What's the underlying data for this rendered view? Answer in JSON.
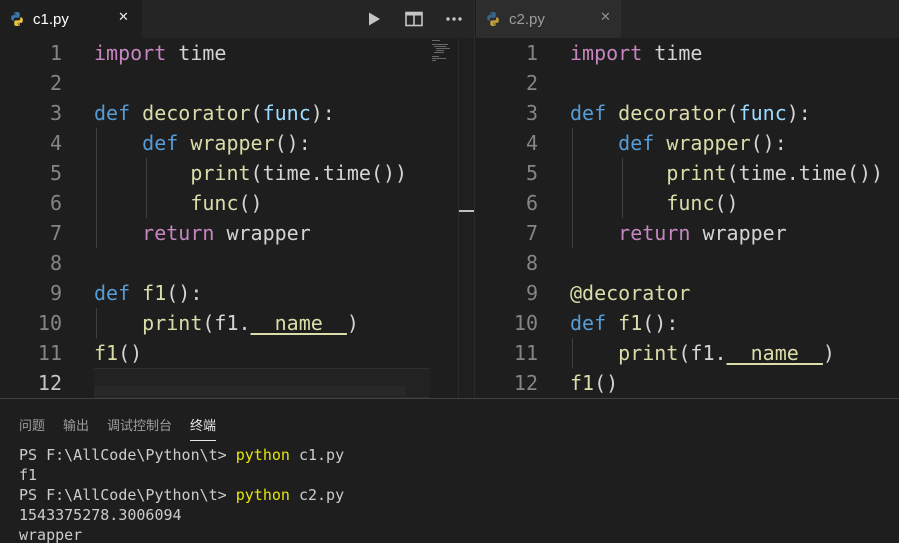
{
  "colors": {
    "background": "#1e1e1e",
    "tab_bar": "#252526",
    "keyword": "#569cd6",
    "control": "#c586c0",
    "function": "#dcdcaa",
    "variable": "#9cdcfe",
    "text": "#d4d4d4",
    "line_number": "#858585",
    "terminal_command": "#e5e510"
  },
  "left_editor": {
    "tab": {
      "label": "c1.py",
      "close": "✕",
      "icon": "python-file-icon"
    },
    "toolbar": {
      "run_icon": "play-icon",
      "split_icon": "split-editor-icon",
      "more_icon": "more-actions-icon"
    },
    "lines": [
      {
        "no": "1",
        "tokens": [
          [
            "kw-ctl",
            "import"
          ],
          [
            "plain",
            " time"
          ]
        ]
      },
      {
        "no": "2",
        "tokens": []
      },
      {
        "no": "3",
        "tokens": [
          [
            "kw",
            "def"
          ],
          [
            "plain",
            " "
          ],
          [
            "fn",
            "decorator"
          ],
          [
            "plain",
            "("
          ],
          [
            "var",
            "func"
          ],
          [
            "plain",
            "):"
          ]
        ]
      },
      {
        "no": "4",
        "tokens": [
          [
            "plain",
            "    "
          ],
          [
            "kw",
            "def"
          ],
          [
            "plain",
            " "
          ],
          [
            "fn",
            "wrapper"
          ],
          [
            "plain",
            "():"
          ]
        ]
      },
      {
        "no": "5",
        "tokens": [
          [
            "plain",
            "        "
          ],
          [
            "fn",
            "print"
          ],
          [
            "plain",
            "(time.time())"
          ]
        ]
      },
      {
        "no": "6",
        "tokens": [
          [
            "plain",
            "        "
          ],
          [
            "fn",
            "func"
          ],
          [
            "plain",
            "()"
          ]
        ]
      },
      {
        "no": "7",
        "tokens": [
          [
            "plain",
            "    "
          ],
          [
            "ctl",
            "return"
          ],
          [
            "plain",
            " wrapper"
          ]
        ]
      },
      {
        "no": "8",
        "tokens": []
      },
      {
        "no": "9",
        "tokens": [
          [
            "kw",
            "def"
          ],
          [
            "plain",
            " "
          ],
          [
            "fn",
            "f1"
          ],
          [
            "plain",
            "():"
          ]
        ]
      },
      {
        "no": "10",
        "tokens": [
          [
            "plain",
            "    "
          ],
          [
            "fn",
            "print"
          ],
          [
            "plain",
            "(f1."
          ],
          [
            "var-u",
            "__name__"
          ],
          [
            "plain",
            ")"
          ]
        ]
      },
      {
        "no": "11",
        "tokens": [
          [
            "fn",
            "f1"
          ],
          [
            "plain",
            "()"
          ]
        ]
      },
      {
        "no": "12",
        "tokens": []
      }
    ],
    "current_line": "12"
  },
  "right_editor": {
    "tab": {
      "label": "c2.py",
      "close": "✕",
      "icon": "python-file-icon"
    },
    "lines": [
      {
        "no": "1",
        "tokens": [
          [
            "kw-ctl",
            "import"
          ],
          [
            "plain",
            " time"
          ]
        ]
      },
      {
        "no": "2",
        "tokens": []
      },
      {
        "no": "3",
        "tokens": [
          [
            "kw",
            "def"
          ],
          [
            "plain",
            " "
          ],
          [
            "fn",
            "decorator"
          ],
          [
            "plain",
            "("
          ],
          [
            "var",
            "func"
          ],
          [
            "plain",
            "):"
          ]
        ]
      },
      {
        "no": "4",
        "tokens": [
          [
            "plain",
            "    "
          ],
          [
            "kw",
            "def"
          ],
          [
            "plain",
            " "
          ],
          [
            "fn",
            "wrapper"
          ],
          [
            "plain",
            "():"
          ]
        ]
      },
      {
        "no": "5",
        "tokens": [
          [
            "plain",
            "        "
          ],
          [
            "fn",
            "print"
          ],
          [
            "plain",
            "(time.time())"
          ]
        ]
      },
      {
        "no": "6",
        "tokens": [
          [
            "plain",
            "        "
          ],
          [
            "fn",
            "func"
          ],
          [
            "plain",
            "()"
          ]
        ]
      },
      {
        "no": "7",
        "tokens": [
          [
            "plain",
            "    "
          ],
          [
            "ctl",
            "return"
          ],
          [
            "plain",
            " wrapper"
          ]
        ]
      },
      {
        "no": "8",
        "tokens": []
      },
      {
        "no": "9",
        "tokens": [
          [
            "fn",
            "@decorator"
          ]
        ]
      },
      {
        "no": "10",
        "tokens": [
          [
            "kw",
            "def"
          ],
          [
            "plain",
            " "
          ],
          [
            "fn",
            "f1"
          ],
          [
            "plain",
            "():"
          ]
        ]
      },
      {
        "no": "11",
        "tokens": [
          [
            "plain",
            "    "
          ],
          [
            "fn",
            "print"
          ],
          [
            "plain",
            "(f1."
          ],
          [
            "var-u",
            "__name__"
          ],
          [
            "plain",
            ")"
          ]
        ]
      },
      {
        "no": "12",
        "tokens": [
          [
            "fn",
            "f1"
          ],
          [
            "plain",
            "()"
          ]
        ]
      }
    ]
  },
  "panel": {
    "tabs": [
      {
        "label": "问题",
        "active": false
      },
      {
        "label": "输出",
        "active": false
      },
      {
        "label": "调试控制台",
        "active": false
      },
      {
        "label": "终端",
        "active": true
      }
    ],
    "terminal": [
      {
        "prompt": "PS F:\\AllCode\\Python\\t> ",
        "cmd": "python",
        "args": " c1.py"
      },
      {
        "text": "f1"
      },
      {
        "prompt": "PS F:\\AllCode\\Python\\t> ",
        "cmd": "python",
        "args": " c2.py"
      },
      {
        "text": "1543375278.3006094"
      },
      {
        "text": "wrapper"
      }
    ]
  }
}
